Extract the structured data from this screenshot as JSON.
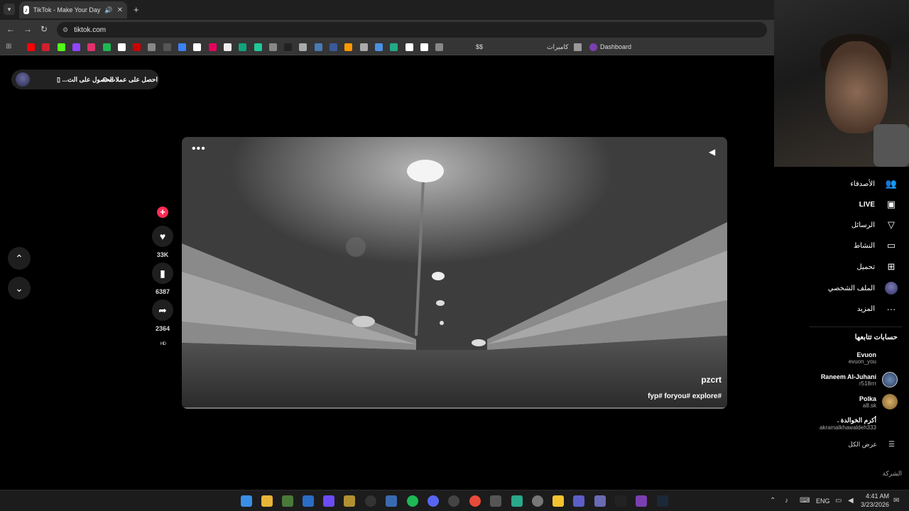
{
  "browser": {
    "tab_title": "TikTok - Make Your Day",
    "new_tab": "+",
    "url": "tiktok.com",
    "bookmarks": [
      {
        "color": "#ff0000"
      },
      {
        "color": "#d02030"
      },
      {
        "color": "#53fc18"
      },
      {
        "color": "#9146ff"
      },
      {
        "color": "#e1306c"
      },
      {
        "color": "#1db954"
      },
      {
        "color": "#ffffff"
      },
      {
        "color": "#c00"
      },
      {
        "color": "#888"
      },
      {
        "color": "#555"
      },
      {
        "color": "#3b82f6"
      },
      {
        "color": "#fff"
      },
      {
        "color": "#e5005c"
      },
      {
        "color": "#eee"
      },
      {
        "color": "#10a37f"
      },
      {
        "color": "#20c997"
      },
      {
        "color": "#888"
      },
      {
        "color": "#222"
      },
      {
        "color": "#aaa"
      },
      {
        "color": "#4a7ab5"
      },
      {
        "color": "#3b5998"
      },
      {
        "color": "#ff9900"
      },
      {
        "color": "#aaa"
      },
      {
        "color": "#4a90e2"
      },
      {
        "color": "#2a8"
      },
      {
        "color": "#fff"
      },
      {
        "color": "#fff"
      },
      {
        "color": "#888"
      }
    ],
    "bookmark_dollar": "$$",
    "bookmark_cameras": "كاميرات",
    "bookmark_dashboard": "Dashboard"
  },
  "promo": {
    "coins_label": "احصل على عملات",
    "app_label": "الحصول على الت..."
  },
  "video": {
    "author": "pzcrt",
    "caption": "fyp# foryou# explore#"
  },
  "actions": {
    "likes": "33K",
    "saves": "6387",
    "shares": "2364",
    "music_label": "ᴴᴰ"
  },
  "sidebar": {
    "items": [
      {
        "label": "الأصدقاء",
        "icon": "friends-icon"
      },
      {
        "label": "LIVE",
        "icon": "live-icon"
      },
      {
        "label": "الرسائل",
        "icon": "messages-icon"
      },
      {
        "label": "النشاط",
        "icon": "activity-icon"
      },
      {
        "label": "تحميل",
        "icon": "upload-icon"
      },
      {
        "label": "الملف الشخصي",
        "icon": "profile-avatar"
      },
      {
        "label": "المزيد",
        "icon": "more-icon"
      }
    ],
    "following_title": "حسابات تتابعها",
    "accounts": [
      {
        "name": "Evuon",
        "handle": "evuon_you"
      },
      {
        "name": "Raneem Al-Juhani",
        "handle": "r518rrr"
      },
      {
        "name": "Polka",
        "handle": "a8.sk"
      },
      {
        "name": "أكرم الخوالدة .",
        "handle": "akramalkhawaldeh333"
      }
    ],
    "see_all": "عرض الكل",
    "company": "الشركة"
  },
  "taskbar": {
    "language": "ENG",
    "time": "4:41 AM",
    "date": "3/23/2026"
  },
  "colors": {
    "accent": "#fe2c55",
    "background": "#000000"
  }
}
